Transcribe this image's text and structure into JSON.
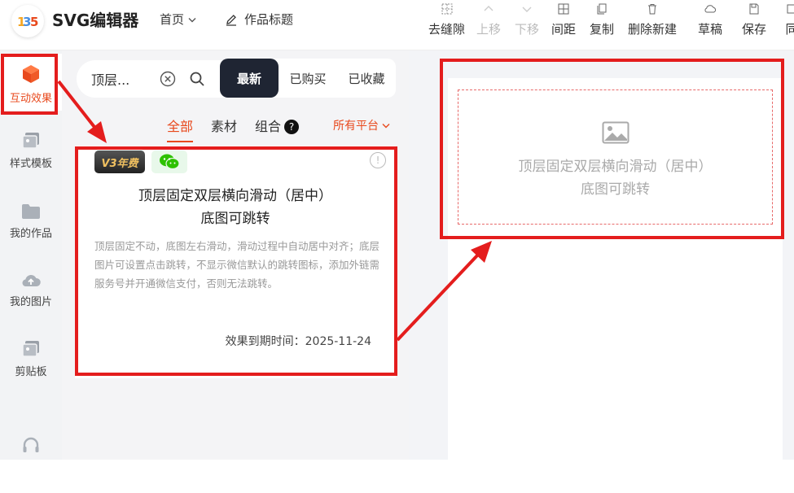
{
  "header": {
    "logo_text": "SVG编辑器",
    "home_menu": "首页",
    "work_title": "作品标题",
    "tools": [
      {
        "label": "去缝隙",
        "icon": "grid-icon",
        "enabled": true
      },
      {
        "label": "上移",
        "icon": "chevron-up-icon",
        "enabled": false
      },
      {
        "label": "下移",
        "icon": "chevron-down-icon",
        "enabled": false
      },
      {
        "label": "间距",
        "icon": "spacing-icon",
        "enabled": true
      },
      {
        "label": "复制",
        "icon": "copy-icon",
        "enabled": true
      },
      {
        "label": "删除新建",
        "icon": "trash-icon",
        "enabled": true
      },
      {
        "label": "草稿",
        "icon": "cloud-icon",
        "enabled": true
      },
      {
        "label": "保存",
        "icon": "save-icon",
        "enabled": true
      },
      {
        "label": "同",
        "icon": "sync-icon",
        "enabled": true
      }
    ]
  },
  "sidebar": {
    "items": [
      {
        "label": "互动效果",
        "icon": "cube-icon",
        "active": true
      },
      {
        "label": "样式模板",
        "icon": "template-icon",
        "active": false
      },
      {
        "label": "我的作品",
        "icon": "folder-icon",
        "active": false
      },
      {
        "label": "我的图片",
        "icon": "cloud-upload-icon",
        "active": false
      },
      {
        "label": "剪贴板",
        "icon": "clipboard-icon",
        "active": false
      },
      {
        "label": "",
        "icon": "headset-icon",
        "active": false
      }
    ]
  },
  "panel": {
    "search_value": "顶层...",
    "segments": [
      "最新",
      "已购买",
      "已收藏"
    ],
    "active_segment": 0,
    "filter_tabs": [
      "全部",
      "素材",
      "组合"
    ],
    "active_filter": 0,
    "platform_filter": "所有平台",
    "card": {
      "badge_text": "V3年费",
      "title_line1": "顶层固定双层横向滑动（居中）",
      "title_line2": "底图可跳转",
      "description": "顶层固定不动，底图左右滑动，滑动过程中自动居中对齐；底层图片可设置点击跳转，不显示微信默认的跳转图标，添加外链需服务号并开通微信支付，否则无法跳转。",
      "expiry": "效果到期时间：2025-11-24"
    }
  },
  "canvas": {
    "placeholder_line1": "顶层固定双层横向滑动（居中）",
    "placeholder_line2": "底图可跳转"
  },
  "colors": {
    "accent": "#e8491d",
    "annotation": "#e41d1d",
    "segment_active_bg": "#1f2533",
    "wechat_green": "#2dc100"
  }
}
